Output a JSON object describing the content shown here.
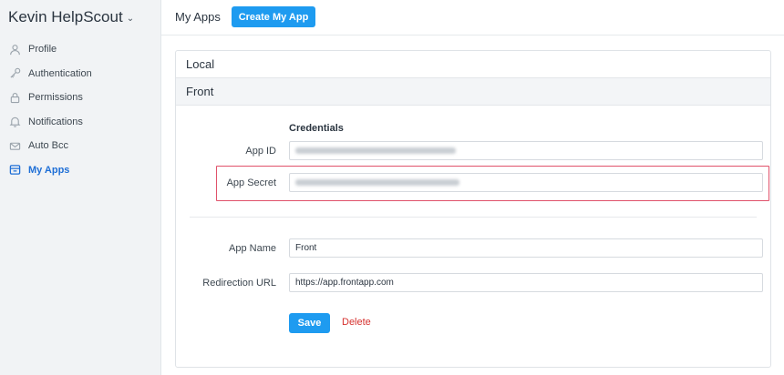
{
  "account": {
    "name": "Kevin HelpScout",
    "caret": "⌄"
  },
  "sidebar": {
    "items": [
      {
        "label": "Profile",
        "icon": "person-icon",
        "active": false
      },
      {
        "label": "Authentication",
        "icon": "key-icon",
        "active": false
      },
      {
        "label": "Permissions",
        "icon": "lock-icon",
        "active": false
      },
      {
        "label": "Notifications",
        "icon": "bell-icon",
        "active": false
      },
      {
        "label": "Auto Bcc",
        "icon": "envelope-icon",
        "active": false
      },
      {
        "label": "My Apps",
        "icon": "apps-icon",
        "active": true
      }
    ]
  },
  "header": {
    "title": "My Apps",
    "create_button": "Create My App"
  },
  "apps": [
    {
      "name": "Local"
    },
    {
      "name": "Front"
    }
  ],
  "form": {
    "credentials_title": "Credentials",
    "app_id": {
      "label": "App ID",
      "value": ""
    },
    "app_secret": {
      "label": "App Secret",
      "value": ""
    },
    "app_name": {
      "label": "App Name",
      "value": "Front"
    },
    "redirect_url": {
      "label": "Redirection URL",
      "value": "https://app.frontapp.com"
    },
    "save_button": "Save",
    "delete_link": "Delete"
  },
  "colors": {
    "accent": "#1e9bf0",
    "active_nav": "#1f6fd6",
    "highlight": "#e0526b",
    "danger": "#d6322f"
  }
}
